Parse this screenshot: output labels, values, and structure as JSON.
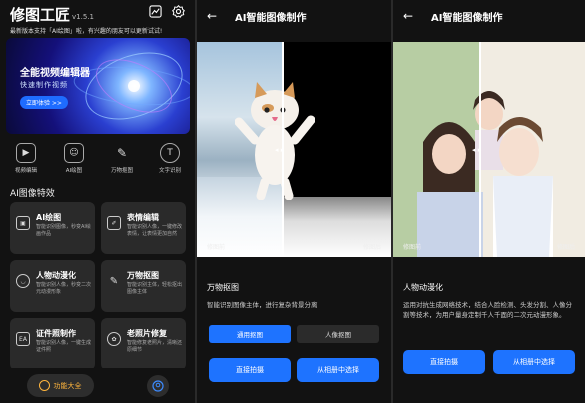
{
  "panel1": {
    "app_title": "修图工匠",
    "version": "v1.5.1",
    "notice": "最新版本支持「AI绘图」啦，有兴趣的朋友可以更新试试!",
    "banner": {
      "title": "全能视频编辑器",
      "subtitle": "快速制作视频",
      "button": "立即体验 >>"
    },
    "quick": [
      {
        "icon": "video-edit-icon",
        "label": "视频编辑"
      },
      {
        "icon": "ai-paint-icon",
        "label": "AI绘图"
      },
      {
        "icon": "magic-wand-icon",
        "label": "万物抠图"
      },
      {
        "icon": "text-recognize-icon",
        "label": "文字识别"
      }
    ],
    "section_title": "AI图像特效",
    "cards": [
      {
        "title": "AI绘图",
        "desc": "智能识别图像，秒变AI绘画作品",
        "icon": "robot-icon"
      },
      {
        "title": "表情编辑",
        "desc": "智能识别人像，一键修改表情，让表情更加自然",
        "icon": "face-edit-icon"
      },
      {
        "title": "人物动漫化",
        "desc": "智能识别人像，秒变二次元动漫形象",
        "icon": "anime-icon"
      },
      {
        "title": "万物抠图",
        "desc": "智能识别主体，轻松抠出图像主体",
        "icon": "cutout-icon"
      },
      {
        "title": "证件照制作",
        "desc": "智能识别人像，一键生成证件照",
        "icon": "id-photo-icon"
      },
      {
        "title": "老照片修复",
        "desc": "智能修复老照片，清晰还原细节",
        "icon": "restore-icon"
      }
    ],
    "bottom": {
      "fab_label": "功能大全"
    }
  },
  "panel2": {
    "title": "AI智能图像制作",
    "before": "修图前",
    "after": "修图后",
    "feature_title": "万物抠图",
    "feature_desc": "智能识别图像主体，进行复杂背景分离",
    "tab_active": "通用抠图",
    "tab_inactive": "人像抠图",
    "btn_camera": "直接拍摄",
    "btn_album": "从相册中选择"
  },
  "panel3": {
    "title": "AI智能图像制作",
    "before": "修图前",
    "after": "修图后",
    "feature_title": "人物动漫化",
    "feature_desc": "运用对抗生成网络技术，结合人脸检测、头发分割、人像分割等技术，为用户量身定制千人千面的二次元动漫形象。",
    "btn_camera": "直接拍摄",
    "btn_album": "从相册中选择"
  },
  "colors": {
    "accent": "#1e73ff",
    "fab": "#ffb53d",
    "bg": "#121212"
  }
}
